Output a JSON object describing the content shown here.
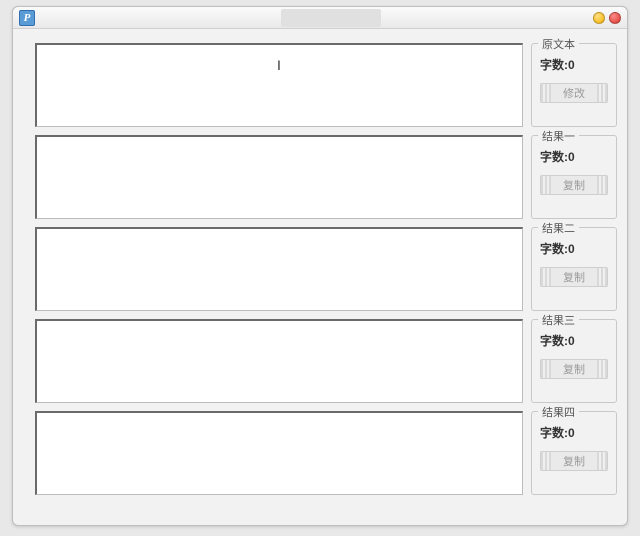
{
  "window": {
    "title": "",
    "app_icon_letter": "P"
  },
  "rows": [
    {
      "legend": "原文本",
      "count_label": "字数:",
      "count_value": "0",
      "button_label": "修改",
      "text": "",
      "show_caret": true
    },
    {
      "legend": "结果一",
      "count_label": "字数:",
      "count_value": "0",
      "button_label": "复制",
      "text": ""
    },
    {
      "legend": "结果二",
      "count_label": "字数:",
      "count_value": "0",
      "button_label": "复制",
      "text": ""
    },
    {
      "legend": "结果三",
      "count_label": "字数:",
      "count_value": "0",
      "button_label": "复制",
      "text": ""
    },
    {
      "legend": "结果四",
      "count_label": "字数:",
      "count_value": "0",
      "button_label": "复制",
      "text": ""
    }
  ]
}
